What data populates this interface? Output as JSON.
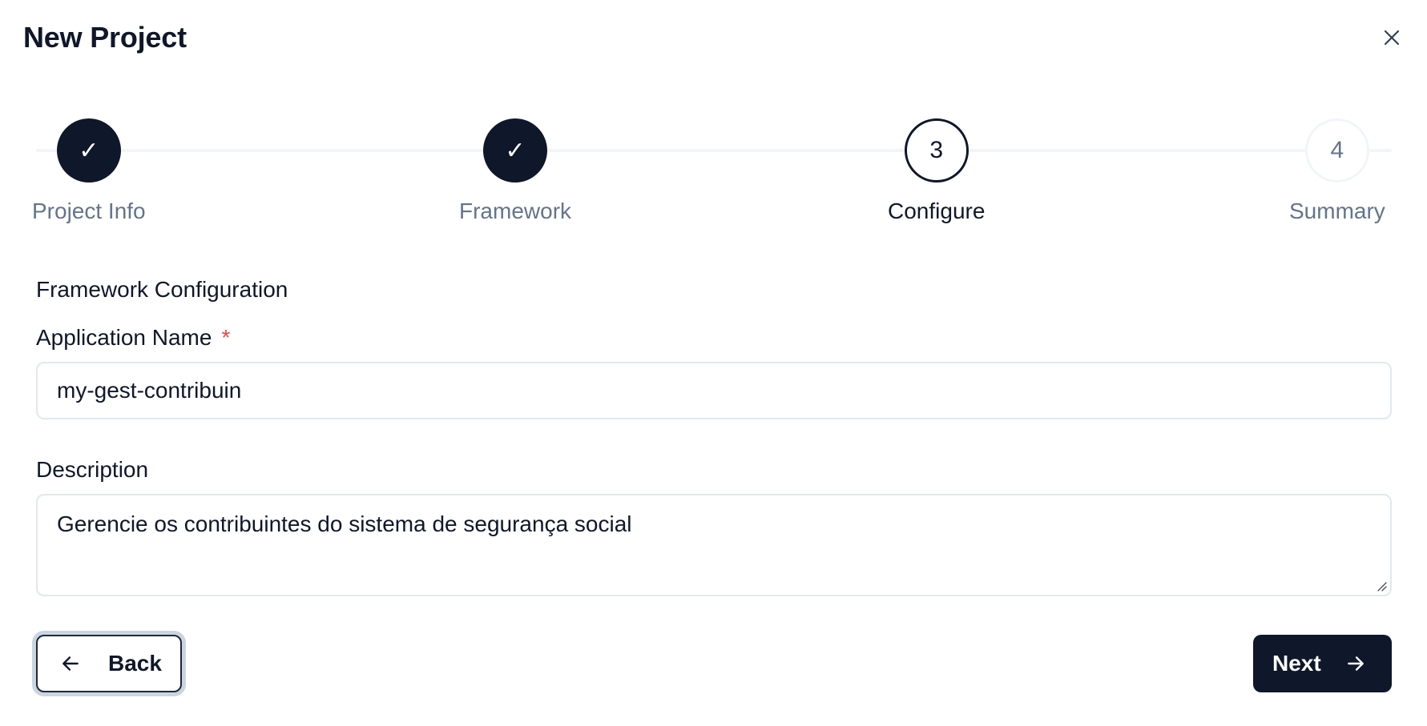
{
  "dialog": {
    "title": "New Project",
    "close_icon": "close-icon"
  },
  "stepper": {
    "steps": [
      {
        "label": "Project Info",
        "status": "complete",
        "marker": "✓"
      },
      {
        "label": "Framework",
        "status": "complete",
        "marker": "✓"
      },
      {
        "label": "Configure",
        "status": "current",
        "marker": "3"
      },
      {
        "label": "Summary",
        "status": "upcoming",
        "marker": "4"
      }
    ]
  },
  "form": {
    "section_title": "Framework Configuration",
    "app_name": {
      "label": "Application Name",
      "required_mark": "*",
      "value": "my-gest-contribuin"
    },
    "description": {
      "label": "Description",
      "value": "Gerencie os contribuintes do sistema de segurança social"
    }
  },
  "footer": {
    "back_label": "Back",
    "next_label": "Next"
  },
  "colors": {
    "primary": "#0f172a",
    "muted": "#64748b",
    "border": "#e2e8f0",
    "required": "#ef4444"
  }
}
